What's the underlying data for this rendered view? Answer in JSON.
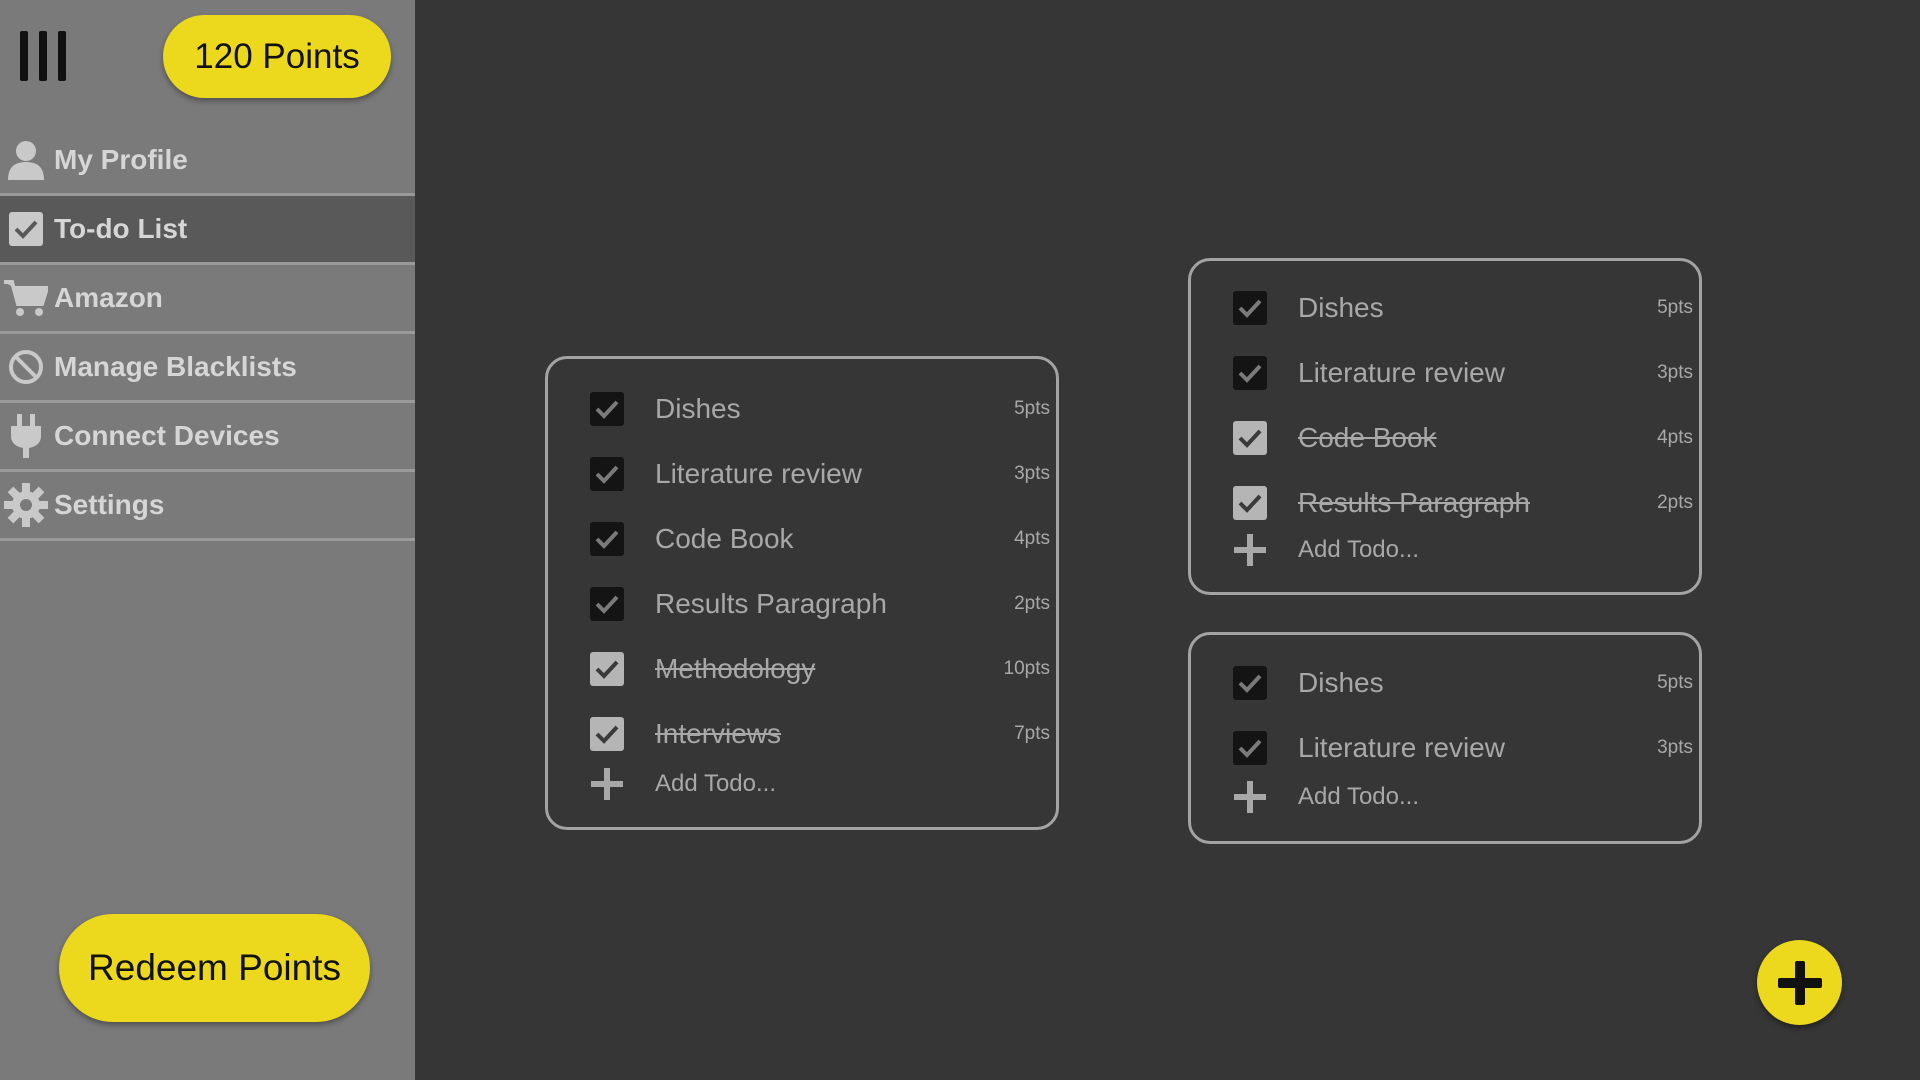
{
  "header": {
    "points_label": "120 Points",
    "menu_icon": "hamburger-menu-icon"
  },
  "sidebar": {
    "items": [
      {
        "label": "My Profile",
        "icon": "user-icon",
        "active": false
      },
      {
        "label": "To-do List",
        "icon": "checkbox-icon",
        "active": true
      },
      {
        "label": "Amazon",
        "icon": "shopping-cart-icon",
        "active": false
      },
      {
        "label": "Manage Blacklists",
        "icon": "block-icon",
        "active": false
      },
      {
        "label": "Connect Devices",
        "icon": "plug-icon",
        "active": false
      },
      {
        "label": "Settings",
        "icon": "gear-icon",
        "active": false
      }
    ],
    "redeem_label": "Redeem Points"
  },
  "lists": [
    {
      "items": [
        {
          "text": "Dishes",
          "points": "5pts",
          "done": false
        },
        {
          "text": "Literature review",
          "points": "3pts",
          "done": false
        },
        {
          "text": "Code Book",
          "points": "4pts",
          "done": false
        },
        {
          "text": "Results Paragraph",
          "points": "2pts",
          "done": false
        },
        {
          "text": "Methodology",
          "points": "10pts",
          "done": true
        },
        {
          "text": "Interviews",
          "points": "7pts",
          "done": true
        }
      ],
      "add_placeholder": "Add Todo..."
    },
    {
      "items": [
        {
          "text": "Dishes",
          "points": "5pts",
          "done": false
        },
        {
          "text": "Literature review",
          "points": "3pts",
          "done": false
        },
        {
          "text": "Code Book",
          "points": "4pts",
          "done": true
        },
        {
          "text": "Results Paragraph",
          "points": "2pts",
          "done": true
        }
      ],
      "add_placeholder": "Add Todo..."
    },
    {
      "items": [
        {
          "text": "Dishes",
          "points": "5pts",
          "done": false
        },
        {
          "text": "Literature review",
          "points": "3pts",
          "done": false
        }
      ],
      "add_placeholder": "Add Todo..."
    }
  ],
  "fab": {
    "icon": "plus-icon"
  },
  "colors": {
    "accent": "#ecd81c",
    "sidebar_bg": "#7a7a7a",
    "sidebar_active_bg": "#595959",
    "main_bg": "#363636",
    "card_border": "#a3a3a3",
    "text_muted": "#a8a8a8"
  }
}
